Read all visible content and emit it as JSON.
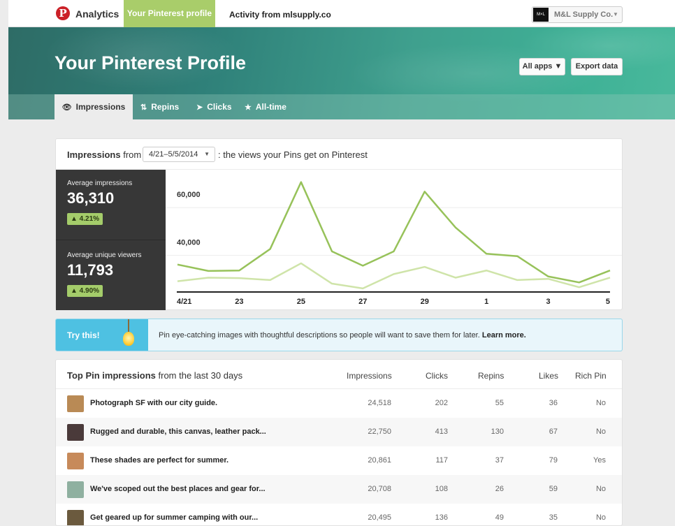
{
  "topnav": {
    "logo_glyph": "P",
    "analytics_label": "Analytics",
    "profile_tab_label": "Your Pinterest profile",
    "activity_tab_label": "Activity from mlsupply.co",
    "account_logo_text": "M×L",
    "account_name": "M&L Supply Co.",
    "account_caret": "▼"
  },
  "hero": {
    "title": "Your Pinterest Profile",
    "all_apps_label": "All apps ▼",
    "export_label": "Export data"
  },
  "subtabs": [
    {
      "icon": "eye-icon",
      "glyph": "👁",
      "label": "Impressions"
    },
    {
      "icon": "repin-icon",
      "glyph": "⇅",
      "label": "Repins"
    },
    {
      "icon": "cursor-icon",
      "glyph": "➤",
      "label": "Clicks"
    },
    {
      "icon": "star-icon",
      "glyph": "★",
      "label": "All-time"
    }
  ],
  "impressions_card": {
    "title_bold": "Impressions",
    "title_from": " from",
    "date_range": "4/21–5/5/2014",
    "date_caret": "▼",
    "description": ": the views your Pins get on Pinterest",
    "avg_impressions_label": "Average impressions",
    "avg_impressions_value": "36,310",
    "avg_impressions_change": "▲ 4.21%",
    "avg_unique_label": "Average unique viewers",
    "avg_unique_value": "11,793",
    "avg_unique_change": "▲ 4.90%"
  },
  "chart_data": {
    "type": "line",
    "x": [
      "4/21",
      "22",
      "23",
      "24",
      "25",
      "26",
      "27",
      "28",
      "29",
      "30",
      "1",
      "2",
      "3",
      "4",
      "5"
    ],
    "x_tick_labels": [
      "4/21",
      "23",
      "25",
      "27",
      "29",
      "1",
      "3",
      "5"
    ],
    "y_tick_labels": [
      "60,000",
      "40,000"
    ],
    "ylim": [
      20000,
      70000
    ],
    "series": [
      {
        "name": "",
        "color": "#97c25a",
        "values": [
          31500,
          28800,
          29000,
          38000,
          66000,
          37000,
          31000,
          37000,
          62000,
          47000,
          36000,
          35000,
          26500,
          24000,
          29000
        ]
      },
      {
        "name": "",
        "color": "#cfe4a9",
        "values": [
          24500,
          26000,
          25800,
          25000,
          32000,
          23500,
          21500,
          27500,
          30500,
          26000,
          29000,
          25000,
          25500,
          22000,
          26000
        ]
      }
    ],
    "grid": true
  },
  "try_this": {
    "label": "Try this!",
    "text": "Pin eye-catching images with thoughtful descriptions so people will want to save them for later.",
    "link": "Learn more."
  },
  "top_pins": {
    "title_bold": "Top Pin impressions",
    "title_rest": " from the last 30 days",
    "columns": [
      "Impressions",
      "Clicks",
      "Repins",
      "Likes",
      "Rich Pin"
    ],
    "rows": [
      {
        "title": "Photograph SF with our city guide.",
        "impressions": "24,518",
        "clicks": "202",
        "repins": "55",
        "likes": "36",
        "rich_pin": "No",
        "thumb_color": "#b98a55"
      },
      {
        "title": "Rugged and durable, this canvas, leather pack...",
        "impressions": "22,750",
        "clicks": "413",
        "repins": "130",
        "likes": "67",
        "rich_pin": "No",
        "thumb_color": "#4a3a3a"
      },
      {
        "title": "These shades are perfect for summer.",
        "impressions": "20,861",
        "clicks": "117",
        "repins": "37",
        "likes": "79",
        "rich_pin": "Yes",
        "thumb_color": "#c78a5a"
      },
      {
        "title": "We've scoped out the best places and gear for...",
        "impressions": "20,708",
        "clicks": "108",
        "repins": "26",
        "likes": "59",
        "rich_pin": "No",
        "thumb_color": "#8fb0a0"
      },
      {
        "title": "Get geared up for summer camping with our...",
        "impressions": "20,495",
        "clicks": "136",
        "repins": "49",
        "likes": "35",
        "rich_pin": "No",
        "thumb_color": "#6b5a3e"
      }
    ]
  }
}
